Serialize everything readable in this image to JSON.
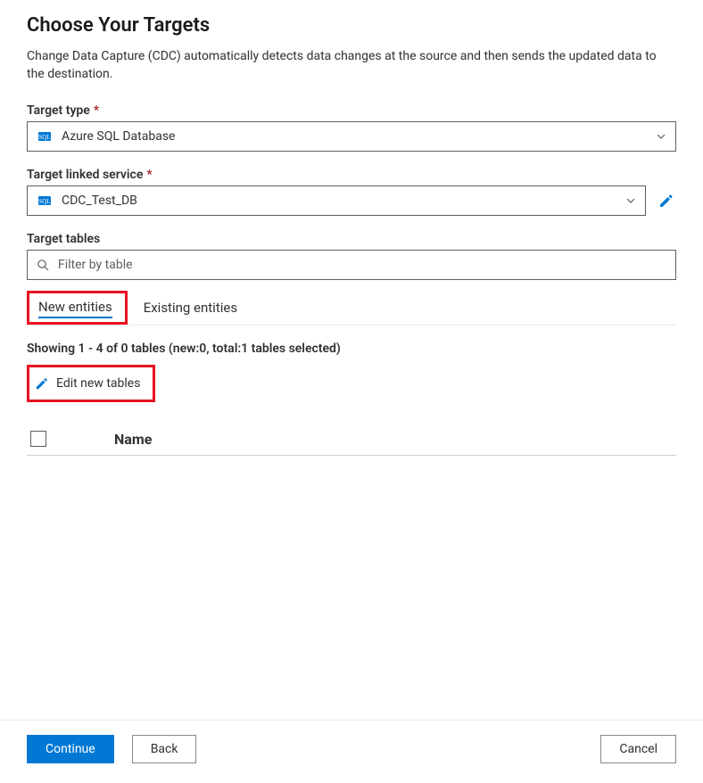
{
  "header": {
    "title": "Choose Your Targets",
    "description": "Change Data Capture (CDC) automatically detects data changes at the source and then sends the updated data to the destination."
  },
  "fields": {
    "target_type": {
      "label": "Target type",
      "required_mark": "*",
      "value": "Azure SQL Database"
    },
    "linked_service": {
      "label": "Target linked service",
      "required_mark": "*",
      "value": "CDC_Test_DB"
    },
    "tables": {
      "label": "Target tables",
      "placeholder": "Filter by table"
    }
  },
  "tabs": {
    "new": "New entities",
    "existing": "Existing entities"
  },
  "showing": "Showing 1 - 4 of 0 tables (new:0, total:1 tables selected)",
  "edit_new_tables": "Edit new tables",
  "table": {
    "column_name": "Name"
  },
  "footer": {
    "continue": "Continue",
    "back": "Back",
    "cancel": "Cancel"
  }
}
